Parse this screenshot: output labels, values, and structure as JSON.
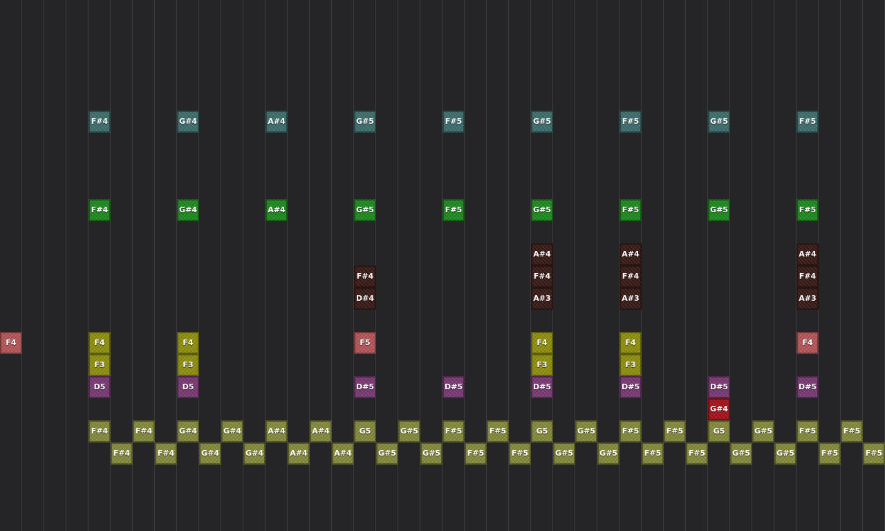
{
  "colors": {
    "background": "#252528",
    "grid_line": "#3b3b3f",
    "teal": "#3f6e6e",
    "green": "#1f8a1f",
    "darkred": "#3a1c18",
    "salmon": "#b5565a",
    "yellow": "#8f8f12",
    "purple": "#7a3a74",
    "red": "#a8141e",
    "olive": "#858a3c"
  },
  "notes": [
    {
      "label": "F#4",
      "col": 4,
      "row": 5,
      "color": "teal"
    },
    {
      "label": "G#4",
      "col": 8,
      "row": 5,
      "color": "teal"
    },
    {
      "label": "A#4",
      "col": 12,
      "row": 5,
      "color": "teal"
    },
    {
      "label": "G#5",
      "col": 16,
      "row": 5,
      "color": "teal"
    },
    {
      "label": "F#5",
      "col": 20,
      "row": 5,
      "color": "teal"
    },
    {
      "label": "G#5",
      "col": 24,
      "row": 5,
      "color": "teal"
    },
    {
      "label": "F#5",
      "col": 28,
      "row": 5,
      "color": "teal"
    },
    {
      "label": "G#5",
      "col": 32,
      "row": 5,
      "color": "teal"
    },
    {
      "label": "F#5",
      "col": 36,
      "row": 5,
      "color": "teal"
    },
    {
      "label": "F#4",
      "col": 4,
      "row": 9,
      "color": "green"
    },
    {
      "label": "G#4",
      "col": 8,
      "row": 9,
      "color": "green"
    },
    {
      "label": "A#4",
      "col": 12,
      "row": 9,
      "color": "green"
    },
    {
      "label": "G#5",
      "col": 16,
      "row": 9,
      "color": "green"
    },
    {
      "label": "F#5",
      "col": 20,
      "row": 9,
      "color": "green"
    },
    {
      "label": "G#5",
      "col": 24,
      "row": 9,
      "color": "green"
    },
    {
      "label": "F#5",
      "col": 28,
      "row": 9,
      "color": "green"
    },
    {
      "label": "G#5",
      "col": 32,
      "row": 9,
      "color": "green"
    },
    {
      "label": "F#5",
      "col": 36,
      "row": 9,
      "color": "green"
    },
    {
      "label": "A#4",
      "col": 24,
      "row": 11,
      "color": "darkred"
    },
    {
      "label": "A#4",
      "col": 28,
      "row": 11,
      "color": "darkred"
    },
    {
      "label": "A#4",
      "col": 36,
      "row": 11,
      "color": "darkred"
    },
    {
      "label": "F#4",
      "col": 16,
      "row": 12,
      "color": "darkred"
    },
    {
      "label": "F#4",
      "col": 24,
      "row": 12,
      "color": "darkred"
    },
    {
      "label": "F#4",
      "col": 28,
      "row": 12,
      "color": "darkred"
    },
    {
      "label": "F#4",
      "col": 36,
      "row": 12,
      "color": "darkred"
    },
    {
      "label": "D#4",
      "col": 16,
      "row": 13,
      "color": "darkred"
    },
    {
      "label": "A#3",
      "col": 24,
      "row": 13,
      "color": "darkred"
    },
    {
      "label": "A#3",
      "col": 28,
      "row": 13,
      "color": "darkred"
    },
    {
      "label": "A#3",
      "col": 36,
      "row": 13,
      "color": "darkred"
    },
    {
      "label": "F4",
      "col": 0,
      "row": 15,
      "color": "salmon"
    },
    {
      "label": "F4",
      "col": 4,
      "row": 15,
      "color": "yellow"
    },
    {
      "label": "F4",
      "col": 8,
      "row": 15,
      "color": "yellow"
    },
    {
      "label": "F5",
      "col": 16,
      "row": 15,
      "color": "salmon"
    },
    {
      "label": "F4",
      "col": 24,
      "row": 15,
      "color": "yellow"
    },
    {
      "label": "F4",
      "col": 28,
      "row": 15,
      "color": "yellow"
    },
    {
      "label": "F4",
      "col": 36,
      "row": 15,
      "color": "salmon"
    },
    {
      "label": "F3",
      "col": 4,
      "row": 16,
      "color": "yellow"
    },
    {
      "label": "F3",
      "col": 8,
      "row": 16,
      "color": "yellow"
    },
    {
      "label": "F3",
      "col": 24,
      "row": 16,
      "color": "yellow"
    },
    {
      "label": "F3",
      "col": 28,
      "row": 16,
      "color": "yellow"
    },
    {
      "label": "D5",
      "col": 4,
      "row": 17,
      "color": "purple"
    },
    {
      "label": "D5",
      "col": 8,
      "row": 17,
      "color": "purple"
    },
    {
      "label": "D#5",
      "col": 16,
      "row": 17,
      "color": "purple"
    },
    {
      "label": "D#5",
      "col": 20,
      "row": 17,
      "color": "purple"
    },
    {
      "label": "D#5",
      "col": 24,
      "row": 17,
      "color": "purple"
    },
    {
      "label": "D#5",
      "col": 28,
      "row": 17,
      "color": "purple"
    },
    {
      "label": "D#5",
      "col": 32,
      "row": 17,
      "color": "purple"
    },
    {
      "label": "D#5",
      "col": 36,
      "row": 17,
      "color": "purple"
    },
    {
      "label": "G#4",
      "col": 32,
      "row": 18,
      "color": "red"
    },
    {
      "label": "F#4",
      "col": 4,
      "row": 19,
      "color": "olive"
    },
    {
      "label": "F#4",
      "col": 6,
      "row": 19,
      "color": "olive"
    },
    {
      "label": "G#4",
      "col": 8,
      "row": 19,
      "color": "olive"
    },
    {
      "label": "G#4",
      "col": 10,
      "row": 19,
      "color": "olive"
    },
    {
      "label": "A#4",
      "col": 12,
      "row": 19,
      "color": "olive"
    },
    {
      "label": "A#4",
      "col": 14,
      "row": 19,
      "color": "olive"
    },
    {
      "label": "G5",
      "col": 16,
      "row": 19,
      "color": "olive"
    },
    {
      "label": "G#5",
      "col": 18,
      "row": 19,
      "color": "olive"
    },
    {
      "label": "F#5",
      "col": 20,
      "row": 19,
      "color": "olive"
    },
    {
      "label": "F#5",
      "col": 22,
      "row": 19,
      "color": "olive"
    },
    {
      "label": "G5",
      "col": 24,
      "row": 19,
      "color": "olive"
    },
    {
      "label": "G#5",
      "col": 26,
      "row": 19,
      "color": "olive"
    },
    {
      "label": "F#5",
      "col": 28,
      "row": 19,
      "color": "olive"
    },
    {
      "label": "F#5",
      "col": 30,
      "row": 19,
      "color": "olive"
    },
    {
      "label": "G5",
      "col": 32,
      "row": 19,
      "color": "olive"
    },
    {
      "label": "G#5",
      "col": 34,
      "row": 19,
      "color": "olive"
    },
    {
      "label": "F#5",
      "col": 36,
      "row": 19,
      "color": "olive"
    },
    {
      "label": "F#5",
      "col": 38,
      "row": 19,
      "color": "olive"
    },
    {
      "label": "F#4",
      "col": 5,
      "row": 20,
      "color": "olive"
    },
    {
      "label": "F#4",
      "col": 7,
      "row": 20,
      "color": "olive"
    },
    {
      "label": "G#4",
      "col": 9,
      "row": 20,
      "color": "olive"
    },
    {
      "label": "G#4",
      "col": 11,
      "row": 20,
      "color": "olive"
    },
    {
      "label": "A#4",
      "col": 13,
      "row": 20,
      "color": "olive"
    },
    {
      "label": "A#4",
      "col": 15,
      "row": 20,
      "color": "olive"
    },
    {
      "label": "G#5",
      "col": 17,
      "row": 20,
      "color": "olive"
    },
    {
      "label": "G#5",
      "col": 19,
      "row": 20,
      "color": "olive"
    },
    {
      "label": "F#5",
      "col": 21,
      "row": 20,
      "color": "olive"
    },
    {
      "label": "F#5",
      "col": 23,
      "row": 20,
      "color": "olive"
    },
    {
      "label": "G#5",
      "col": 25,
      "row": 20,
      "color": "olive"
    },
    {
      "label": "G#5",
      "col": 27,
      "row": 20,
      "color": "olive"
    },
    {
      "label": "F#5",
      "col": 29,
      "row": 20,
      "color": "olive"
    },
    {
      "label": "F#5",
      "col": 31,
      "row": 20,
      "color": "olive"
    },
    {
      "label": "G#5",
      "col": 33,
      "row": 20,
      "color": "olive"
    },
    {
      "label": "G#5",
      "col": 35,
      "row": 20,
      "color": "olive"
    },
    {
      "label": "F#5",
      "col": 37,
      "row": 20,
      "color": "olive"
    },
    {
      "label": "F#5",
      "col": 39,
      "row": 20,
      "color": "olive"
    }
  ]
}
